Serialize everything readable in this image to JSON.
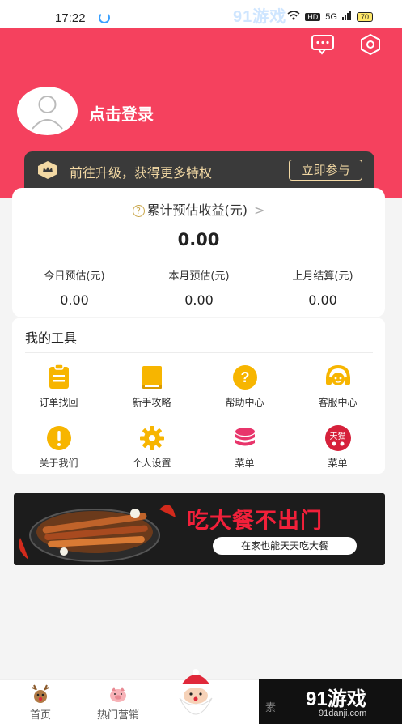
{
  "status_bar": {
    "time": "17:22",
    "hd": "HD",
    "signal": "5G",
    "battery": "70"
  },
  "watermark": {
    "top": "91游戏",
    "brand": "91游戏",
    "site": "91danji.com"
  },
  "header": {
    "bg_color": "#f5415e",
    "message_icon": "chat-bubble-icon",
    "settings_icon": "gear-icon",
    "login_text": "点击登录"
  },
  "vip": {
    "text": "前往升级，获得更多特权",
    "button": "立即参与",
    "icon": "crown-icon"
  },
  "earnings": {
    "title": "累计预估收益(元)",
    "help_icon": "?",
    "chevron": ">",
    "total": "0.00",
    "columns": [
      {
        "label": "今日预估(元)",
        "value": "0.00"
      },
      {
        "label": "本月预估(元)",
        "value": "0.00"
      },
      {
        "label": "上月结算(元)",
        "value": "0.00"
      }
    ]
  },
  "tools": {
    "title": "我的工具",
    "items": [
      {
        "label": "订单找回",
        "icon": "clipboard-icon"
      },
      {
        "label": "新手攻略",
        "icon": "book-icon"
      },
      {
        "label": "帮助中心",
        "icon": "question-icon"
      },
      {
        "label": "客服中心",
        "icon": "headset-icon"
      },
      {
        "label": "关于我们",
        "icon": "info-icon"
      },
      {
        "label": "个人设置",
        "icon": "gear-icon"
      },
      {
        "label": "菜单",
        "icon": "stack-icon"
      },
      {
        "label": "菜单",
        "icon": "tmall-icon",
        "badge": "天猫"
      }
    ]
  },
  "banner": {
    "title": "吃大餐不出门",
    "subtitle": "在家也能天天吃大餐"
  },
  "tabbar": {
    "items": [
      {
        "label": "首页",
        "icon": "reindeer-icon"
      },
      {
        "label": "热门营销",
        "icon": "pig-icon"
      },
      {
        "label": "",
        "icon": "santa-icon"
      },
      {
        "label": "素",
        "icon": "partial-icon"
      }
    ]
  }
}
